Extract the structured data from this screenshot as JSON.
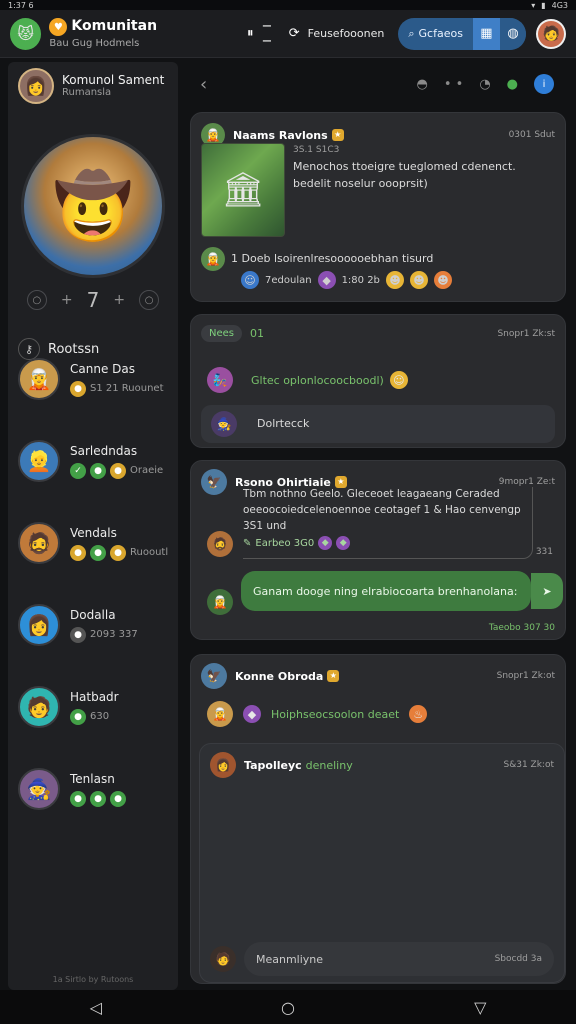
{
  "status_bar": {
    "time": "1:37 6",
    "icons_left": "◉ ▣",
    "battery": "4G3"
  },
  "app": {
    "title": "Komunitan",
    "subtitle": "Bau Gug Hodmels",
    "center_label": "Feusefooonen",
    "search_label": "Gcfaeos"
  },
  "sidebar": {
    "user_name": "Komunol Sament",
    "user_sub": "Rumansla",
    "stat_value": "7",
    "section_label": "Rootssn",
    "contacts": [
      {
        "name": "Canne Das",
        "meta": "S1 21  Ruounet"
      },
      {
        "name": "Sarledndas",
        "meta": "Oraeie"
      },
      {
        "name": "Vendals",
        "meta": "Ruooutl"
      },
      {
        "name": "Dodalla",
        "meta": "2093 337"
      },
      {
        "name": "Hatbadr",
        "meta": "630"
      },
      {
        "name": "Tenlasn",
        "meta": ""
      }
    ],
    "footer": "1a Sirtlo by Rutoons"
  },
  "feed": {
    "post1": {
      "author": "Naams Ravlons",
      "time": "0301 Sdut",
      "meta": "3S.1 S1C3",
      "text": "Menochos ttoeigre tueglomed cdenenct. bedelit noselur oooprsit)",
      "reply": "1 Doeb lsoirenlresoooooebhan tisurd",
      "reaction_label": "7edoulan",
      "reaction_count": "1:80 2b"
    },
    "post2": {
      "tag": "Nees",
      "tag_count": "01",
      "time": "Snopr1 Zk:st",
      "line1": "Gltec oplonlocoocboodl)",
      "line2": "Dolrtecck"
    },
    "post3": {
      "author": "Rsono Ohirtiaie",
      "time": "9mopr1 Ze:t",
      "text": "Tbm nothno Geelo. Gleceoet leagaeang Ceraded oeeoocoiedcelenoennoe ceotagef 1 & Hao cenvengp 3S1 und",
      "inline": "Earbeo 3G0",
      "side_count": "331",
      "bubble": "Ganam dooge ning elrabiocoarta brenhanolana:",
      "foot": "Taeobo 307 30"
    },
    "post4": {
      "author": "Konne Obroda",
      "time": "Snopr1 Zk:ot",
      "line1": "Hoiphseocsoolon deaet",
      "sub_author": "Tapolleyc",
      "sub_green": "deneliny",
      "sub_time": "S&31 Zk:ot",
      "input_placeholder": "Meanmliyne",
      "input_meta": "Sbocdd  3a"
    }
  }
}
